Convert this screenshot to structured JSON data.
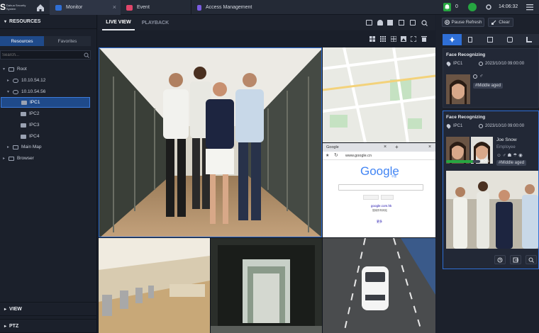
{
  "brand": {
    "name": "Dahua Security System",
    "logo_letter": "S"
  },
  "tabs": [
    {
      "label": "Monitor",
      "close": "×"
    },
    {
      "label": "Event"
    },
    {
      "label": "Access Management"
    }
  ],
  "status": {
    "alarm_count": "0",
    "time": "14:06:32"
  },
  "left": {
    "title": "RESOURCES",
    "subtabs": [
      "Resources",
      "Favorites"
    ],
    "search_placeholder": "Search...",
    "tree": [
      "Root",
      "10.10.54.12",
      "10.10.54.56",
      "IPC1",
      "IPC2",
      "IPC3",
      "IPC4",
      "Main Map",
      "Browser"
    ],
    "view": "VIEW",
    "ptz": "PTZ"
  },
  "center": {
    "tabs": [
      "LIVE VIEW",
      "PLAYBACK"
    ]
  },
  "browser": {
    "tab_title": "Google",
    "url": "www.google.cn",
    "logo": "Google",
    "logo_sub": "中国",
    "link": "google.com.hk",
    "link_sub": "搜索所有网站",
    "footer": "更多"
  },
  "right": {
    "pause_label": "Pause Refresh",
    "clear_label": "Clear",
    "cards": [
      {
        "title": "Face Recognizing",
        "channel": "IPC1",
        "time": "2023/10/10 09:00:00",
        "tag": "#Middle aged"
      },
      {
        "title": "Face Recognizing",
        "channel": "IPC1",
        "time": "2023/10/10 09:00:00",
        "name": "Joe Snow",
        "role": "Employee",
        "similarity": "80%",
        "similarity_value": 0.8,
        "tag": "#Middle aged"
      }
    ]
  },
  "colors": {
    "accent": "#2f6fd6",
    "alarm_green": "#26a641",
    "bg": "#1a1f2b"
  }
}
